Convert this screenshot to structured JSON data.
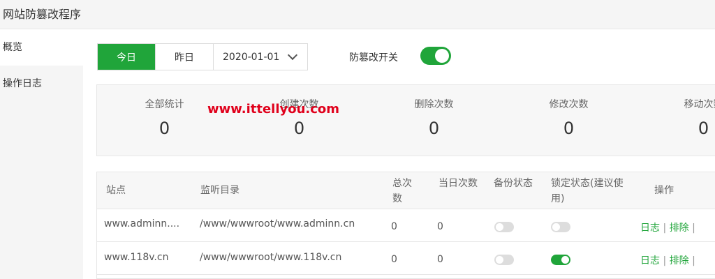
{
  "app": {
    "title": "网站防篡改程序"
  },
  "sidebar": {
    "items": [
      {
        "label": "概览"
      },
      {
        "label": "操作日志"
      }
    ]
  },
  "toolbar": {
    "today_label": "今日",
    "yesterday_label": "昨日",
    "date_value": "2020-01-01",
    "switch_label": "防篡改开关",
    "switch_on": true
  },
  "stats": [
    {
      "label": "全部统计",
      "value": "0"
    },
    {
      "label": "创建次数",
      "value": "0"
    },
    {
      "label": "删除次数",
      "value": "0"
    },
    {
      "label": "修改次数",
      "value": "0"
    },
    {
      "label": "移动次数",
      "value": "0"
    }
  ],
  "watermark": "www.ittellyou.com",
  "table": {
    "headers": [
      "站点",
      "监听目录",
      "总次数",
      "当日次数",
      "备份状态",
      "锁定状态(建议使用)",
      "操作"
    ],
    "rows": [
      {
        "site": "www.adminn....",
        "dir": "/www/wwwroot/www.adminn.cn",
        "total": "0",
        "today": "0",
        "backup_on": false,
        "lock_on": false,
        "ops": [
          "日志",
          "排除"
        ]
      },
      {
        "site": "www.118v.cn",
        "dir": "/www/wwwroot/www.118v.cn",
        "total": "0",
        "today": "0",
        "backup_on": false,
        "lock_on": true,
        "ops": [
          "日志",
          "排除"
        ]
      }
    ]
  },
  "colors": {
    "accent": "#20a53a",
    "watermark": "#e0001b"
  }
}
